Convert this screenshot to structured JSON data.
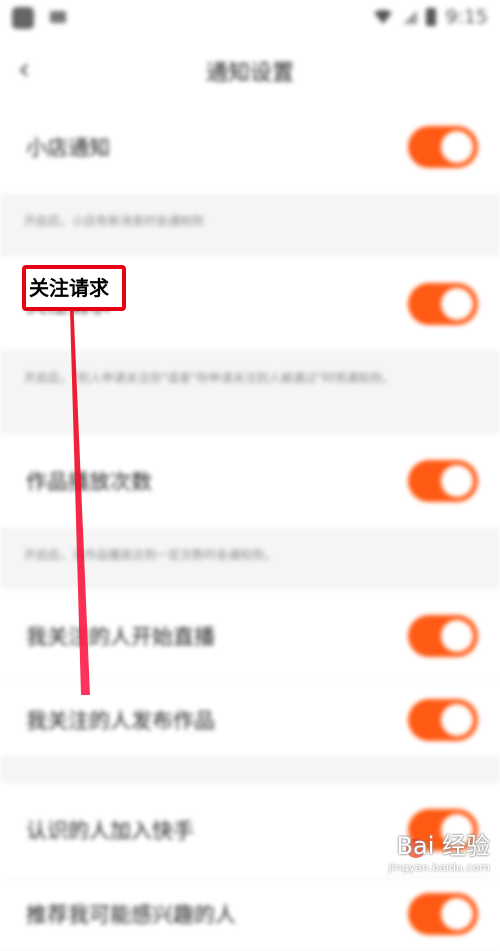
{
  "status_bar": {
    "time": "9:15"
  },
  "header": {
    "title": "通知设置",
    "back_icon": "chevron-left-icon"
  },
  "rows": [
    {
      "label": "小店通知",
      "enabled": true,
      "desc": "开启后，小店有新消息时会通知你"
    },
    {
      "label": "关注请求",
      "enabled": true,
      "desc": "开启后，\"别人申请关注你\"或者\"你申请关注别人被通过\"时将通知你。"
    },
    {
      "label": "作品播放次数",
      "enabled": true,
      "desc": "开启后，当作品播放达到一定次数时会通知你。"
    },
    {
      "label": "我关注的人开始直播",
      "enabled": true
    },
    {
      "label": "我关注的人发布作品",
      "enabled": true
    },
    {
      "label": "认识的人加入快手",
      "enabled": true
    },
    {
      "label": "推荐我可能感兴趣的人",
      "enabled": true
    }
  ],
  "watermark": {
    "text": "Bai 经验",
    "sub": "jingyan.baidu.com"
  },
  "colors": {
    "toggle_on": "#ff5a14",
    "highlight": "#e60012"
  }
}
